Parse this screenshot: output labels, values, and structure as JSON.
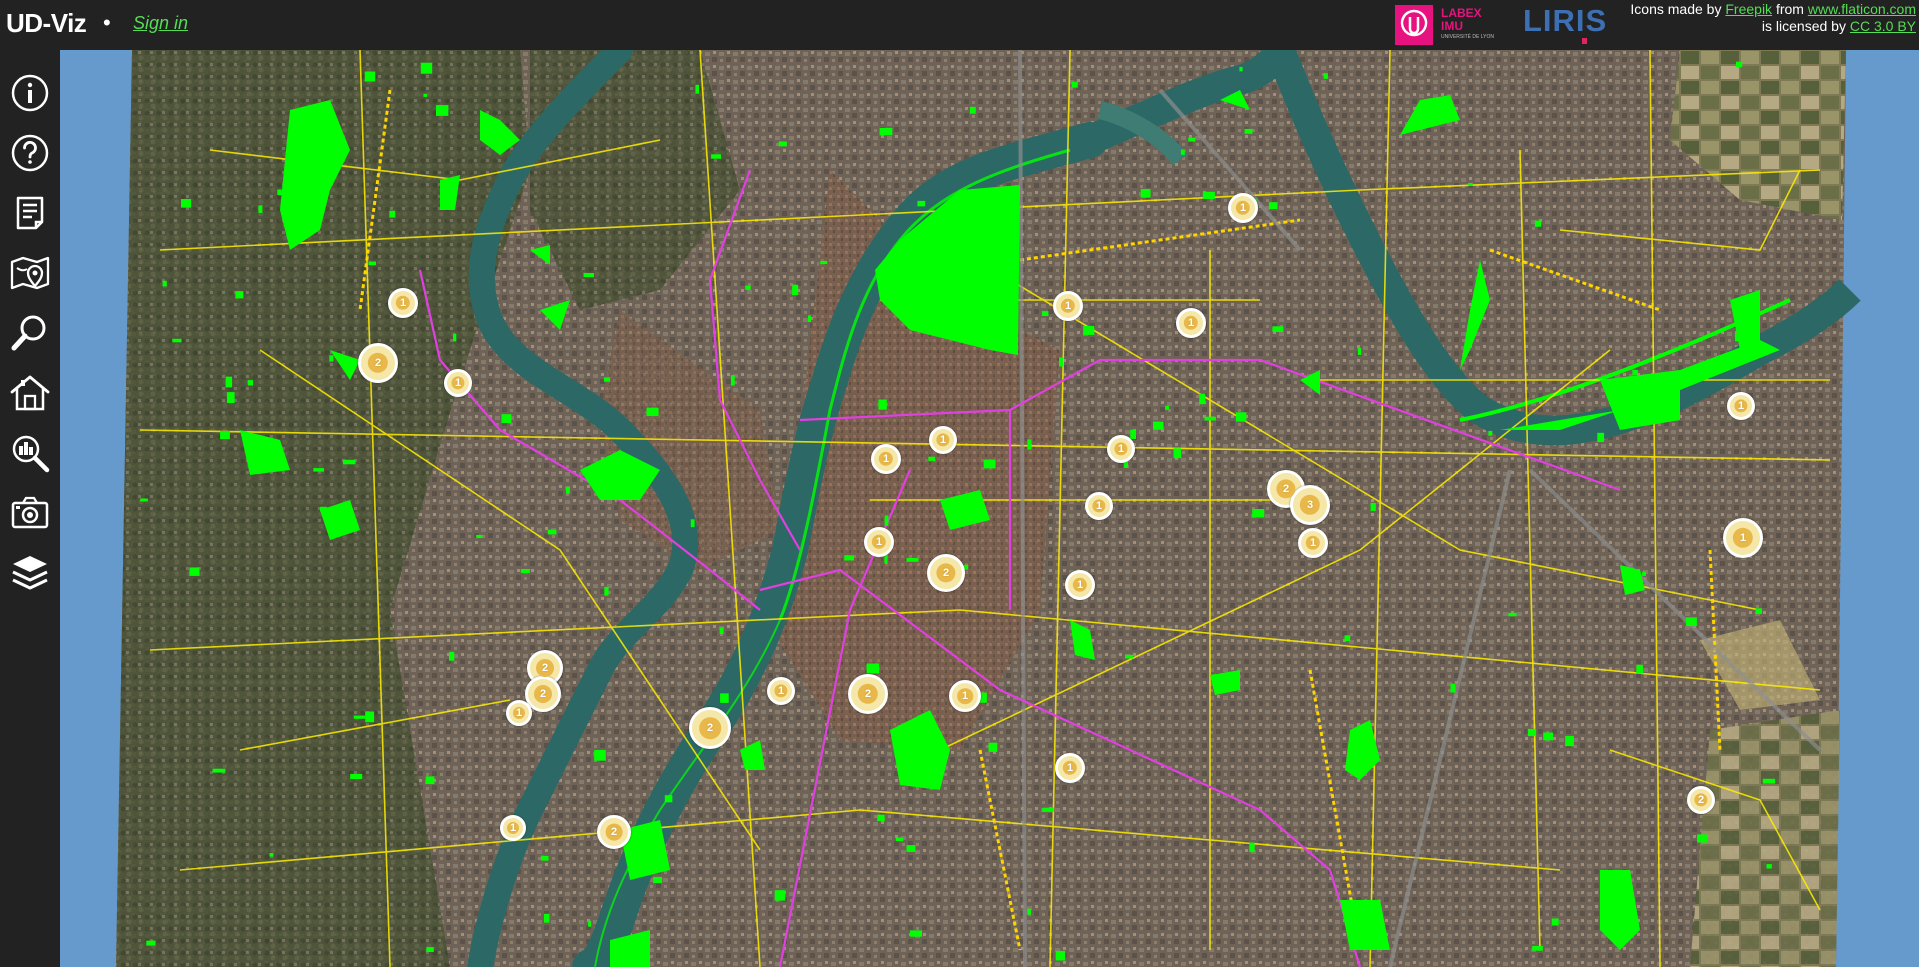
{
  "header": {
    "app_title": "UD-Viz",
    "title_dot": "•",
    "sign_in": "Sign in",
    "logos": {
      "labex_line1": "LABEX",
      "labex_line2": "IMU",
      "labex_sub": "UNIVERSITÉ DE LYON",
      "liris": "LIRIS"
    },
    "credits": {
      "line1_prefix": "Icons made by",
      "freepik": "Freepik",
      "line1_mid": "from",
      "flaticon": "www.flaticon.com",
      "line2_prefix": "is licensed by",
      "license": "CC 3.0 BY"
    }
  },
  "sidebar": {
    "items": [
      {
        "name": "about-button",
        "icon": "info-icon"
      },
      {
        "name": "help-button",
        "icon": "question-icon"
      },
      {
        "name": "documents-button",
        "icon": "document-icon"
      },
      {
        "name": "map-button",
        "icon": "map-pin-icon"
      },
      {
        "name": "search-button",
        "icon": "search-icon"
      },
      {
        "name": "building-button",
        "icon": "house-icon"
      },
      {
        "name": "inspect-button",
        "icon": "inspect-city-icon"
      },
      {
        "name": "camera-button",
        "icon": "camera-icon"
      },
      {
        "name": "layers-button",
        "icon": "layers-icon"
      }
    ]
  },
  "map": {
    "colors": {
      "background": "#6699cc",
      "terrain": "#6e6356",
      "river": "#2c6866",
      "parks": "#00ff00",
      "roads": "#ffee00",
      "transit": "#e040e0",
      "cluster": "#f4e7a8"
    },
    "clusters": [
      {
        "label": "1"
      },
      {
        "label": "2"
      },
      {
        "label": "1"
      },
      {
        "label": "1"
      },
      {
        "label": "1"
      },
      {
        "label": "1"
      },
      {
        "label": "1"
      },
      {
        "label": "1"
      },
      {
        "label": "1"
      },
      {
        "label": "1"
      },
      {
        "label": "2"
      },
      {
        "label": "3"
      },
      {
        "label": "1"
      },
      {
        "label": "1"
      },
      {
        "label": "1"
      },
      {
        "label": "1"
      },
      {
        "label": "2"
      },
      {
        "label": "1"
      },
      {
        "label": "2"
      },
      {
        "label": "2"
      },
      {
        "label": "1"
      },
      {
        "label": "1"
      },
      {
        "label": "2"
      },
      {
        "label": "1"
      },
      {
        "label": "2"
      },
      {
        "label": "1"
      },
      {
        "label": "2"
      },
      {
        "label": "1"
      },
      {
        "label": "2"
      }
    ]
  }
}
